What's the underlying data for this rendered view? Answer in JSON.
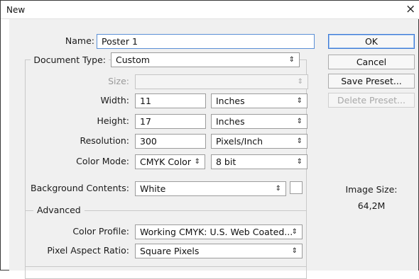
{
  "window": {
    "title": "New",
    "close_glyph": "×"
  },
  "name_field": {
    "label": "Name:",
    "value": "Poster 1"
  },
  "document_type": {
    "label": "Document Type:",
    "value": "Custom"
  },
  "size": {
    "label": "Size:",
    "value": ""
  },
  "width": {
    "label": "Width:",
    "value": "11",
    "unit": "Inches"
  },
  "height": {
    "label": "Height:",
    "value": "17",
    "unit": "Inches"
  },
  "resolution": {
    "label": "Resolution:",
    "value": "300",
    "unit": "Pixels/Inch"
  },
  "color_mode": {
    "label": "Color Mode:",
    "value": "CMYK Color",
    "depth": "8 bit"
  },
  "background": {
    "label": "Background Contents:",
    "value": "White",
    "swatch_color": "#ffffff"
  },
  "advanced": {
    "legend": "Advanced",
    "color_profile": {
      "label": "Color Profile:",
      "value": "Working CMYK:  U.S. Web Coated..."
    },
    "pixel_aspect": {
      "label": "Pixel Aspect Ratio:",
      "value": "Square Pixels"
    }
  },
  "buttons": {
    "ok": "OK",
    "cancel": "Cancel",
    "save_preset": "Save Preset...",
    "delete_preset": "Delete Preset..."
  },
  "image_size": {
    "label": "Image Size:",
    "value": "64,2M"
  },
  "icons": {
    "dropdown": "updown-arrows-icon",
    "close": "close-icon"
  },
  "colors": {
    "focus_border": "#5b8fd6",
    "default_button_border": "#3d7ad6",
    "panel_bg": "#f0f0f0"
  }
}
